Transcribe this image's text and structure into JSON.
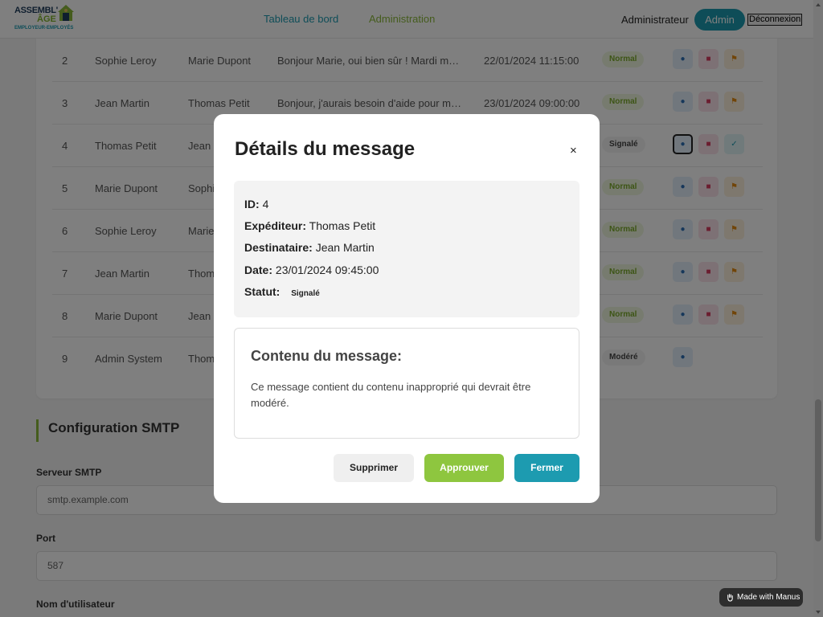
{
  "header": {
    "logo": {
      "line1": "ASSEMBL'",
      "line2": "ÂGE",
      "tagline": "EMPLOYEUR-EMPLOYÉS"
    },
    "nav": [
      {
        "label": "Tableau de bord"
      },
      {
        "label": "Administration"
      }
    ],
    "role_label": "Administrateur",
    "user_badge": "Admin",
    "logout_label": "Déconnexion"
  },
  "messages_table": {
    "rows": [
      {
        "id": "2",
        "sender": "Sophie Leroy",
        "recipient": "Marie Dupont",
        "content": "Bonjour Marie, oui bien sûr ! Mardi me c...",
        "date": "22/01/2024 11:15:00",
        "status": "Normal"
      },
      {
        "id": "3",
        "sender": "Jean Martin",
        "recipient": "Thomas Petit",
        "content": "Bonjour, j'aurais besoin d'aide pour mo...",
        "date": "23/01/2024 09:00:00",
        "status": "Normal"
      },
      {
        "id": "4",
        "sender": "Thomas Petit",
        "recipient": "Jean Martin",
        "content": "",
        "date": "",
        "status": "Signalé"
      },
      {
        "id": "5",
        "sender": "Marie Dupont",
        "recipient": "Sophie Leroy",
        "content": "",
        "date": "",
        "status": "Normal"
      },
      {
        "id": "6",
        "sender": "Sophie Leroy",
        "recipient": "Marie Dupont",
        "content": "",
        "date": "",
        "status": "Normal"
      },
      {
        "id": "7",
        "sender": "Jean Martin",
        "recipient": "Thomas Petit",
        "content": "",
        "date": "",
        "status": "Normal"
      },
      {
        "id": "8",
        "sender": "Marie Dupont",
        "recipient": "Jean Martin",
        "content": "",
        "date": "",
        "status": "Normal"
      },
      {
        "id": "9",
        "sender": "Admin System",
        "recipient": "Thomas Petit",
        "content": "",
        "date": "",
        "status": "Modéré"
      }
    ]
  },
  "smtp": {
    "title": "Configuration SMTP",
    "server_label": "Serveur SMTP",
    "server_placeholder": "smtp.example.com",
    "port_label": "Port",
    "port_placeholder": "587",
    "username_label": "Nom d'utilisateur"
  },
  "modal": {
    "title": "Détails du message",
    "close_symbol": "×",
    "fields": {
      "id_label": "ID:",
      "id_value": "4",
      "sender_label": "Expéditeur:",
      "sender_value": "Thomas Petit",
      "recipient_label": "Destinataire:",
      "recipient_value": "Jean Martin",
      "date_label": "Date:",
      "date_value": "23/01/2024 09:45:00",
      "status_label": "Statut:",
      "status_value": "Signalé"
    },
    "content_title": "Contenu du message:",
    "content_text": "Ce message contient du contenu inapproprié qui devrait être modéré.",
    "buttons": {
      "delete": "Supprimer",
      "approve": "Approuver",
      "close": "Fermer"
    }
  },
  "footer_badge": "Made with Manus",
  "colors": {
    "teal": "#1d9bb0",
    "green": "#8ec63f",
    "overlay": "rgba(0,0,0,0.5)"
  }
}
